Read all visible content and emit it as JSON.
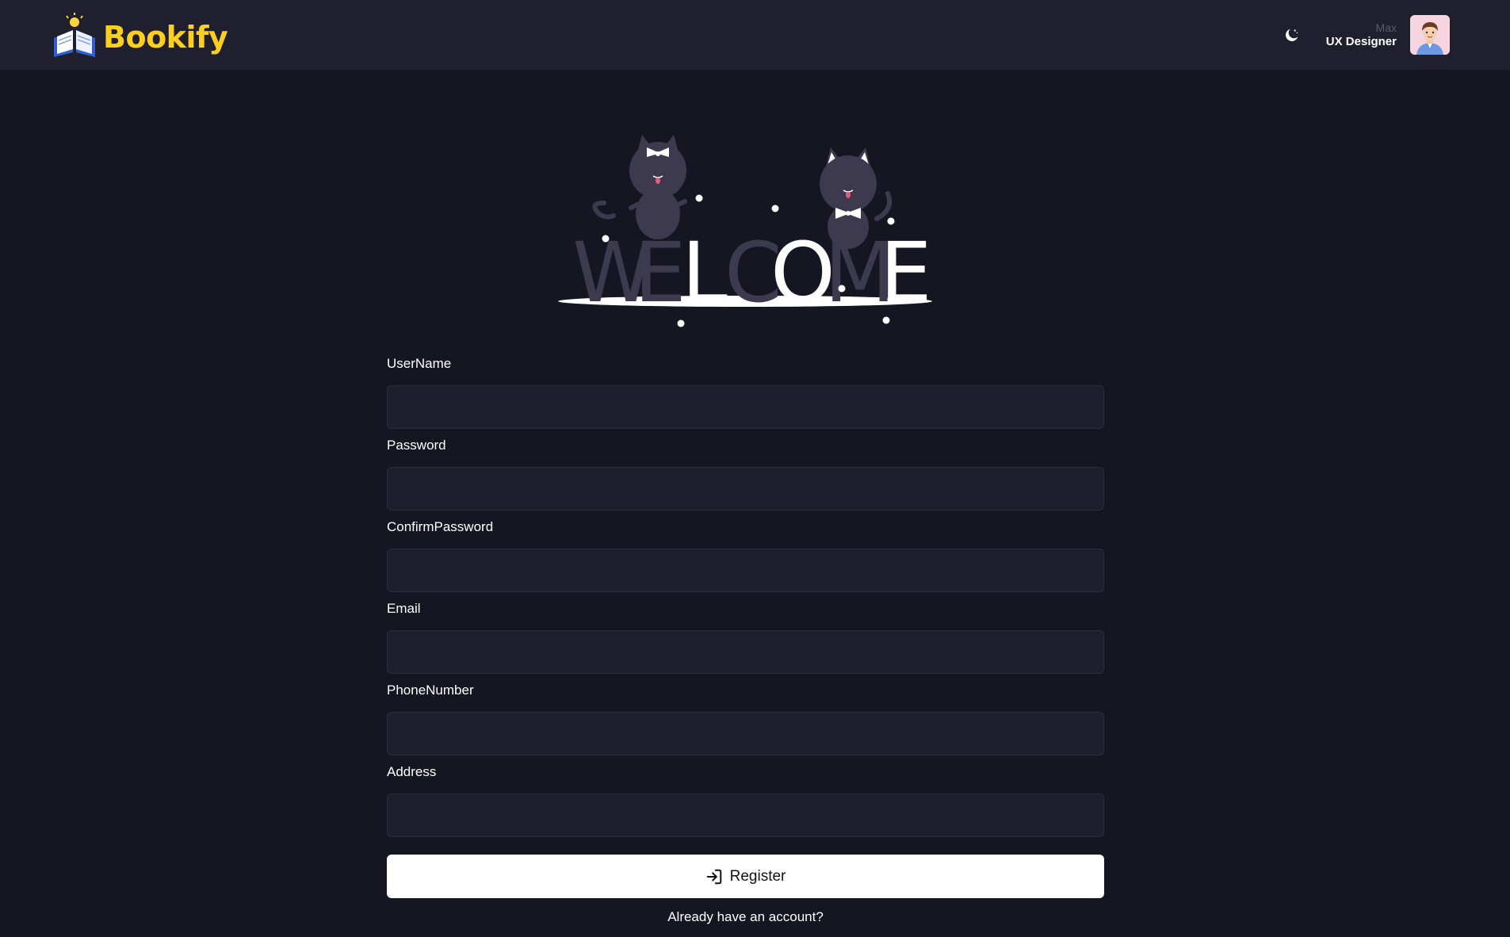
{
  "header": {
    "brand": "Bookify",
    "theme_icon": "moon-icon",
    "user": {
      "name": "Max",
      "role": "UX Designer"
    }
  },
  "welcome": {
    "letters": [
      "W",
      "E",
      "L",
      "C",
      "O",
      "M",
      "E"
    ]
  },
  "form": {
    "fields": [
      {
        "label": "UserName",
        "value": "",
        "placeholder": ""
      },
      {
        "label": "Password",
        "value": "",
        "placeholder": ""
      },
      {
        "label": "ConfirmPassword",
        "value": "",
        "placeholder": ""
      },
      {
        "label": "Email",
        "value": "",
        "placeholder": ""
      },
      {
        "label": "PhoneNumber",
        "value": "",
        "placeholder": ""
      },
      {
        "label": "Address",
        "value": "",
        "placeholder": ""
      }
    ],
    "submit_label": "Register",
    "submit_icon": "login-arrow-icon",
    "login_link": "Already have an account?"
  },
  "colors": {
    "page_bg": "#161623",
    "header_bg": "#1f1f2d",
    "brand": "#ffcf1f",
    "input_bg": "#1e1e2c",
    "muted_letter": "#3d3a4f"
  }
}
